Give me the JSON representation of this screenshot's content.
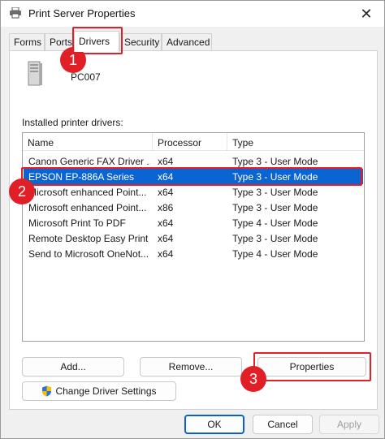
{
  "window": {
    "title": "Print Server Properties",
    "close_glyph": "✕"
  },
  "tabs": [
    {
      "label": "Forms"
    },
    {
      "label": "Ports"
    },
    {
      "label": "Drivers"
    },
    {
      "label": "Security"
    },
    {
      "label": "Advanced"
    }
  ],
  "active_tab": "Drivers",
  "server": {
    "name": "PC007"
  },
  "drivers": {
    "label": "Installed printer drivers:",
    "columns": [
      "Name",
      "Processor",
      "Type"
    ],
    "rows": [
      {
        "name": "Canon Generic FAX Driver ...",
        "processor": "x64",
        "type": "Type 3 - User Mode"
      },
      {
        "name": "EPSON EP-886A Series",
        "processor": "x64",
        "type": "Type 3 - User Mode"
      },
      {
        "name": "Microsoft enhanced Point...",
        "processor": "x64",
        "type": "Type 3 - User Mode"
      },
      {
        "name": "Microsoft enhanced Point...",
        "processor": "x86",
        "type": "Type 3 - User Mode"
      },
      {
        "name": "Microsoft Print To PDF",
        "processor": "x64",
        "type": "Type 4 - User Mode"
      },
      {
        "name": "Remote Desktop Easy Print",
        "processor": "x64",
        "type": "Type 3 - User Mode"
      },
      {
        "name": "Send to Microsoft OneNot...",
        "processor": "x64",
        "type": "Type 4 - User Mode"
      }
    ],
    "selected_index": 1
  },
  "buttons": {
    "add": "Add...",
    "remove": "Remove...",
    "properties": "Properties",
    "change_settings": "Change Driver Settings",
    "ok": "OK",
    "cancel": "Cancel",
    "apply": "Apply"
  },
  "annotations": {
    "badge1": "1",
    "badge2": "2",
    "badge3": "3",
    "color": "#e01f26"
  },
  "colors": {
    "selection": "#0a64d2",
    "accent": "#0a5fc9"
  }
}
